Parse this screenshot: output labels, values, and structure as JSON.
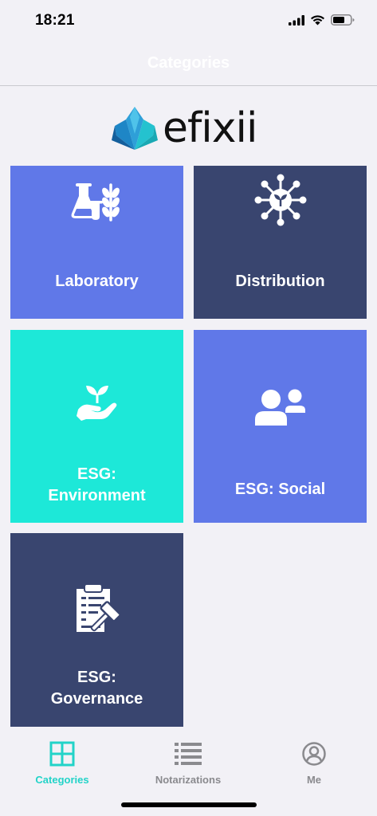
{
  "status_bar": {
    "time": "18:21"
  },
  "header": {
    "title": "Categories"
  },
  "logo": {
    "text": "efixii"
  },
  "categories": [
    {
      "label": "Laboratory",
      "color": "#6078e8",
      "icon": "lab-flask-wheat-icon"
    },
    {
      "label": "Distribution",
      "color": "#39456f",
      "icon": "distribution-network-icon"
    },
    {
      "label": "ESG:\nEnvironment",
      "color": "#1de8d8",
      "icon": "hand-sprout-icon"
    },
    {
      "label": "ESG: Social",
      "color": "#6078e8",
      "icon": "people-icon"
    },
    {
      "label": "ESG:\nGovernance",
      "color": "#39456f",
      "icon": "clipboard-gavel-icon"
    }
  ],
  "tab_bar": {
    "tabs": [
      {
        "label": "Categories",
        "icon": "grid-icon",
        "active": true
      },
      {
        "label": "Notarizations",
        "icon": "list-icon",
        "active": false
      },
      {
        "label": "Me",
        "icon": "user-circle-icon",
        "active": false
      }
    ],
    "active_color": "#22d3c8",
    "inactive_color": "#8a8a8e"
  }
}
